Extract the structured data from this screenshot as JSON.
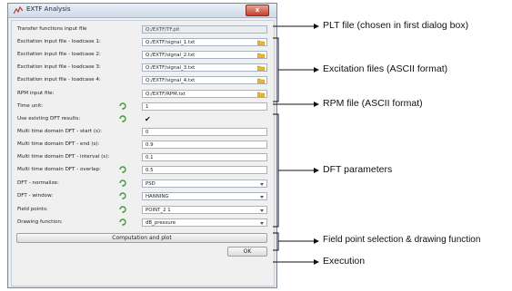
{
  "window": {
    "title": "EXTF Analysis",
    "close_label": "x"
  },
  "form": {
    "transfer": {
      "label": "Transfer functions input file",
      "value": "Q:/EXTF/TF.plt"
    },
    "exc1": {
      "label": "Excitation input file - loadcase 1:",
      "value": "Q:/EXTF/signal_1.txt"
    },
    "exc2": {
      "label": "Excitation input file - loadcase 2:",
      "value": "Q:/EXTF/signal_2.txt"
    },
    "exc3": {
      "label": "Excitation input file - loadcase 3:",
      "value": "Q:/EXTF/signal_3.txt"
    },
    "exc4": {
      "label": "Excitation input file - loadcase 4:",
      "value": "Q:/EXTF/signal_4.txt"
    },
    "rpm": {
      "label": "RPM input file:",
      "value": "Q:/EXTF/RPM.txt"
    },
    "time_unit": {
      "label": "Time unit:",
      "value": "1"
    },
    "use_existing": {
      "label": "Use existing DFT results:",
      "checked_glyph": "✔"
    },
    "dft_start": {
      "label": "Multi time domain DFT - start (s):",
      "value": "0"
    },
    "dft_end": {
      "label": "Multi time domain DFT - end (s):",
      "value": "0.9"
    },
    "dft_interval": {
      "label": "Multi time domain DFT - interval (s):",
      "value": "0.1"
    },
    "dft_overlap": {
      "label": "Multi time domain DFT - overlap:",
      "value": "0.5"
    },
    "dft_normalize": {
      "label": "DFT - normalize:",
      "value": "PSD"
    },
    "dft_window": {
      "label": "DFT - window:",
      "value": "HANNING"
    },
    "field_points": {
      "label": "Field points:",
      "value": "POINT_2 1"
    },
    "drawing_function": {
      "label": "Drawing function:",
      "value": "dB_pressure"
    }
  },
  "buttons": {
    "compute": "Computation and plot",
    "ok": "OK"
  },
  "annotations": {
    "plt": "PLT file (chosen in first dialog box)",
    "excitation": "Excitation files (ASCII format)",
    "rpm": "RPM file (ASCII format)",
    "dft": "DFT parameters",
    "fieldpoint": "Field point selection & drawing function",
    "execution": "Execution"
  },
  "colors": {
    "gear": "#3e9b3e",
    "folder": "#e8b72f"
  }
}
